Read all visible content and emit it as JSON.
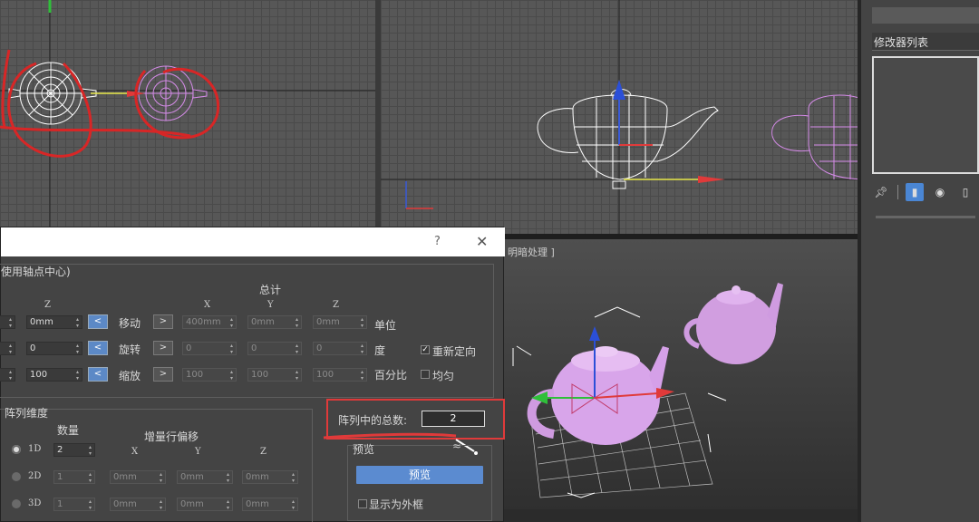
{
  "viewports": {
    "perspective_label": "明暗处理 ]"
  },
  "command_panel": {
    "modifier_list": "修改器列表"
  },
  "dialog": {
    "help": "?",
    "close": "✕",
    "pivot_label": "使用轴点中心)",
    "total_title": "总计",
    "axis": {
      "z_left": "Z",
      "x": "X",
      "y": "Y",
      "z": "Z"
    },
    "move": {
      "label": "移动",
      "z_value": "0mm",
      "x": "400mm",
      "y": "0mm",
      "z": "0mm",
      "unit": "单位"
    },
    "rotate": {
      "label": "旋转",
      "z_value": "0",
      "x": "0",
      "y": "0",
      "z": "0",
      "unit": "度",
      "reorient_label": "重新定向"
    },
    "scale": {
      "label": "缩放",
      "z_value": "100",
      "x": "100",
      "y": "100",
      "z": "100",
      "unit": "百分比",
      "uniform_label": "均匀"
    },
    "array_dim": {
      "title": "阵列维度",
      "count_header": "数量",
      "offset_header": "增量行偏移",
      "x": "X",
      "y": "Y",
      "z": "Z",
      "rows": [
        {
          "label": "1D",
          "count": "2",
          "x": "",
          "y": "",
          "z": ""
        },
        {
          "label": "2D",
          "count": "1",
          "x": "0mm",
          "y": "0mm",
          "z": "0mm"
        },
        {
          "label": "3D",
          "count": "1",
          "x": "0mm",
          "y": "0mm",
          "z": "0mm"
        }
      ]
    },
    "total_in_array_label": "阵列中的总数:",
    "total_in_array_value": "2",
    "preview_label": "预览",
    "preview_button": "预览",
    "display_as_box": "显示为外框"
  },
  "colors": {
    "annotation_red": "#e03a3a",
    "accent_blue": "#5b8bd0",
    "teapot_pink": "#d9a0e6"
  }
}
